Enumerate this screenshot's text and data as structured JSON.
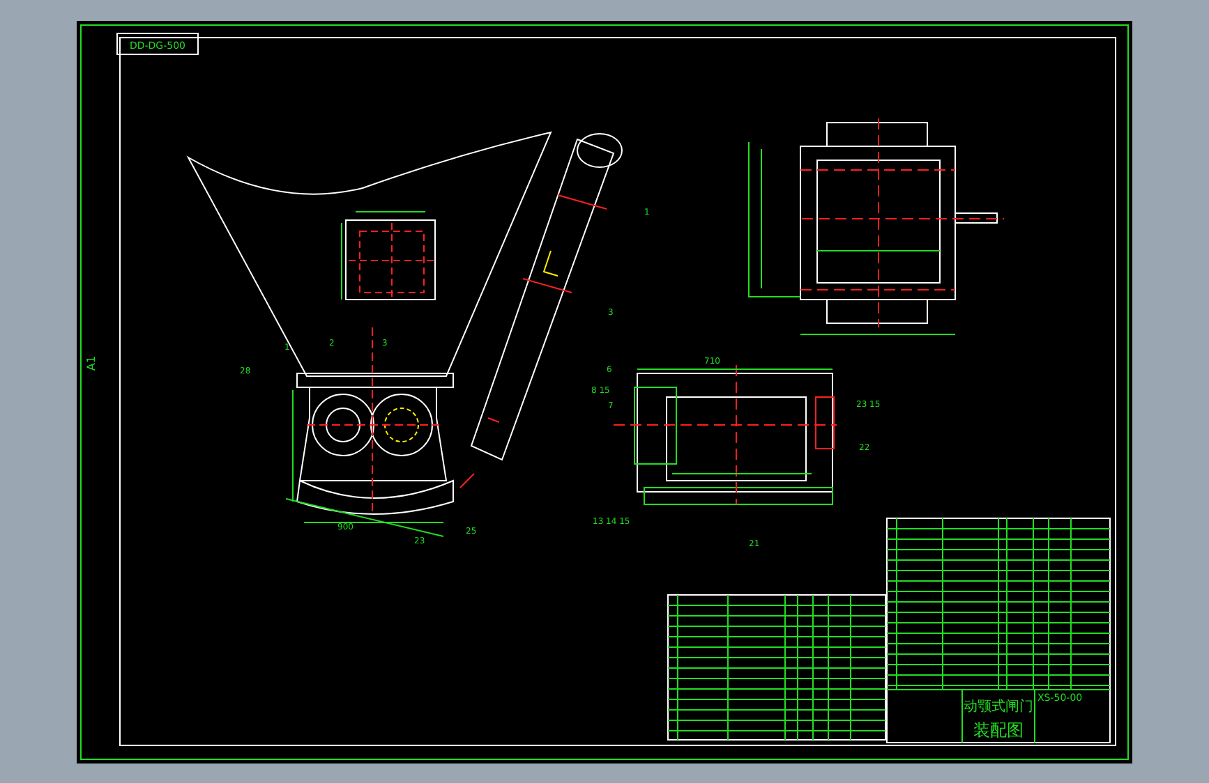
{
  "sheet": {
    "drawing_number": "DD-DG-500",
    "side_label": "A1"
  },
  "callouts": [
    {
      "text": "1"
    },
    {
      "text": "3"
    },
    {
      "text": "1"
    },
    {
      "text": "2"
    },
    {
      "text": "3"
    },
    {
      "text": "28"
    },
    {
      "text": "23"
    },
    {
      "text": "25"
    },
    {
      "text": "900"
    },
    {
      "text": "6"
    },
    {
      "text": "7"
    },
    {
      "text": "8 15"
    },
    {
      "text": "22"
    },
    {
      "text": "23 15"
    },
    {
      "text": "710"
    },
    {
      "text": "13 14 15"
    },
    {
      "text": "21"
    }
  ],
  "title_block": {
    "name": "动颚式闸门",
    "type": "装配图",
    "code": "XS-50-00"
  }
}
